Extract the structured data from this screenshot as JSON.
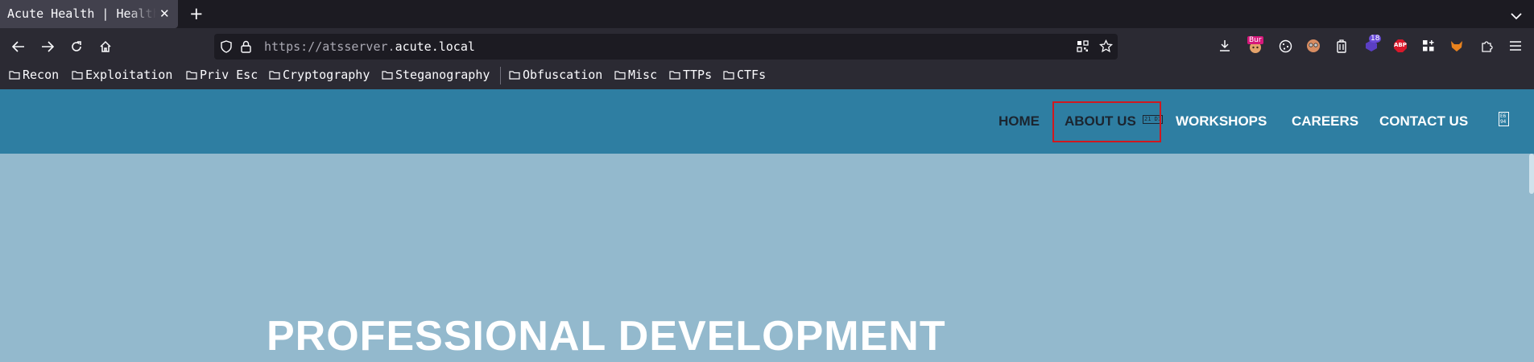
{
  "browser": {
    "tab": {
      "title": "Acute Health | Health, Safety",
      "close_label": "✕"
    },
    "new_tab_label": "+",
    "url": {
      "scheme": "https://",
      "host_sub": "atsserver.",
      "host_main": "acute.local"
    },
    "bookmarks": [
      "Recon",
      "Exploitation",
      "Priv Esc",
      "Cryptography",
      "Steganography",
      "Obfuscation",
      "Misc",
      "TTPs",
      "CTFs"
    ],
    "extensions": {
      "burp_badge": "Bur",
      "counter_badge": "18",
      "abp_label": "ABP"
    }
  },
  "site": {
    "nav": {
      "home": "HOME",
      "about": "ABOUT US",
      "about_glyph": "21 D1",
      "workshops": "WORKSHOPS",
      "careers": "CAREERS",
      "contact": "CONTACT US",
      "menu_glyph": "E6 94"
    },
    "hero_title": "PROFESSIONAL DEVELOPMENT"
  },
  "colors": {
    "tabbar": "#1c1b22",
    "toolbar": "#2b2a33",
    "site_nav": "#2e7ea2",
    "hero_bg": "#93b9cd",
    "highlight": "#d0181f"
  }
}
